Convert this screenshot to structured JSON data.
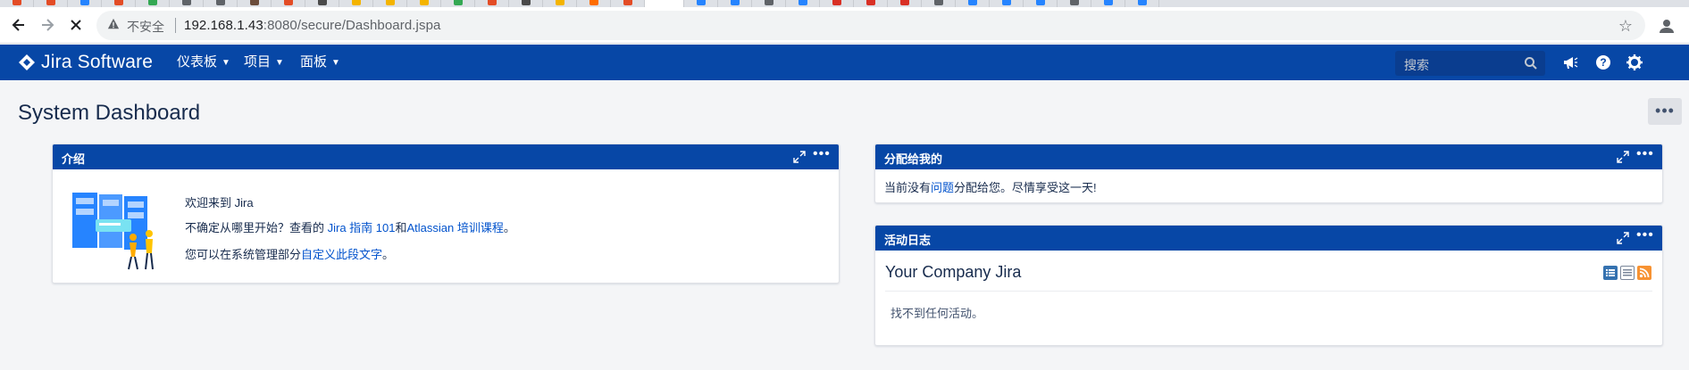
{
  "browser": {
    "insecure_label": "不安全",
    "url_host": "192.168.1.43",
    "url_rest": ":8080/secure/Dashboard.jspa",
    "tabs": [
      {
        "color": "#e34c26"
      },
      {
        "color": "#e34c26"
      },
      {
        "color": "#2684ff"
      },
      {
        "color": "#e34c26"
      },
      {
        "color": "#34a853"
      },
      {
        "color": "#5f6368"
      },
      {
        "color": "#5f6368"
      },
      {
        "color": "#6b4c3b"
      },
      {
        "color": "#e34c26"
      },
      {
        "color": "#4a4a4a"
      },
      {
        "color": "#f4b400"
      },
      {
        "color": "#f4b400"
      },
      {
        "color": "#f4b400"
      },
      {
        "color": "#34a853"
      },
      {
        "color": "#e34c26"
      },
      {
        "color": "#4a4a4a"
      },
      {
        "color": "#f4b400"
      },
      {
        "color": "#ff6d00"
      },
      {
        "color": "#e34c26"
      },
      {
        "color": "#ffffff"
      },
      {
        "color": "#2684ff"
      },
      {
        "color": "#2684ff"
      },
      {
        "color": "#5f6368"
      },
      {
        "color": "#2684ff"
      },
      {
        "color": "#d93025"
      },
      {
        "color": "#d93025"
      },
      {
        "color": "#d93025"
      },
      {
        "color": "#5f6368"
      },
      {
        "color": "#2684ff"
      },
      {
        "color": "#2684ff"
      },
      {
        "color": "#2684ff"
      },
      {
        "color": "#5f6368"
      },
      {
        "color": "#2684ff"
      },
      {
        "color": "#2684ff"
      }
    ]
  },
  "header": {
    "logo_text": "Jira Software",
    "menus": [
      "仪表板",
      "项目",
      "面板"
    ],
    "search_placeholder": "搜索",
    "colors": {
      "bar": "#0747a6"
    }
  },
  "page": {
    "title": "System Dashboard",
    "more_label": "•••"
  },
  "gadgets": {
    "intro": {
      "title": "介绍",
      "welcome": "欢迎来到 Jira",
      "line2_prefix": "不确定从哪里开始？查看的 ",
      "line2_link1": "Jira 指南 101",
      "line2_mid": "和",
      "line2_link2": "Atlassian 培训课程",
      "line2_suffix": "。",
      "line3_prefix": "您可以在系统管理部分",
      "line3_link": "自定义此段文字",
      "line3_suffix": "。"
    },
    "assigned": {
      "title": "分配给我的",
      "text_prefix": "当前没有",
      "text_link": "问题",
      "text_suffix": "分配给您。尽情享受这一天!"
    },
    "activity": {
      "title": "活动日志",
      "subtitle": "Your Company Jira",
      "empty": "找不到任何活动。"
    },
    "more_glyph": "•••"
  }
}
